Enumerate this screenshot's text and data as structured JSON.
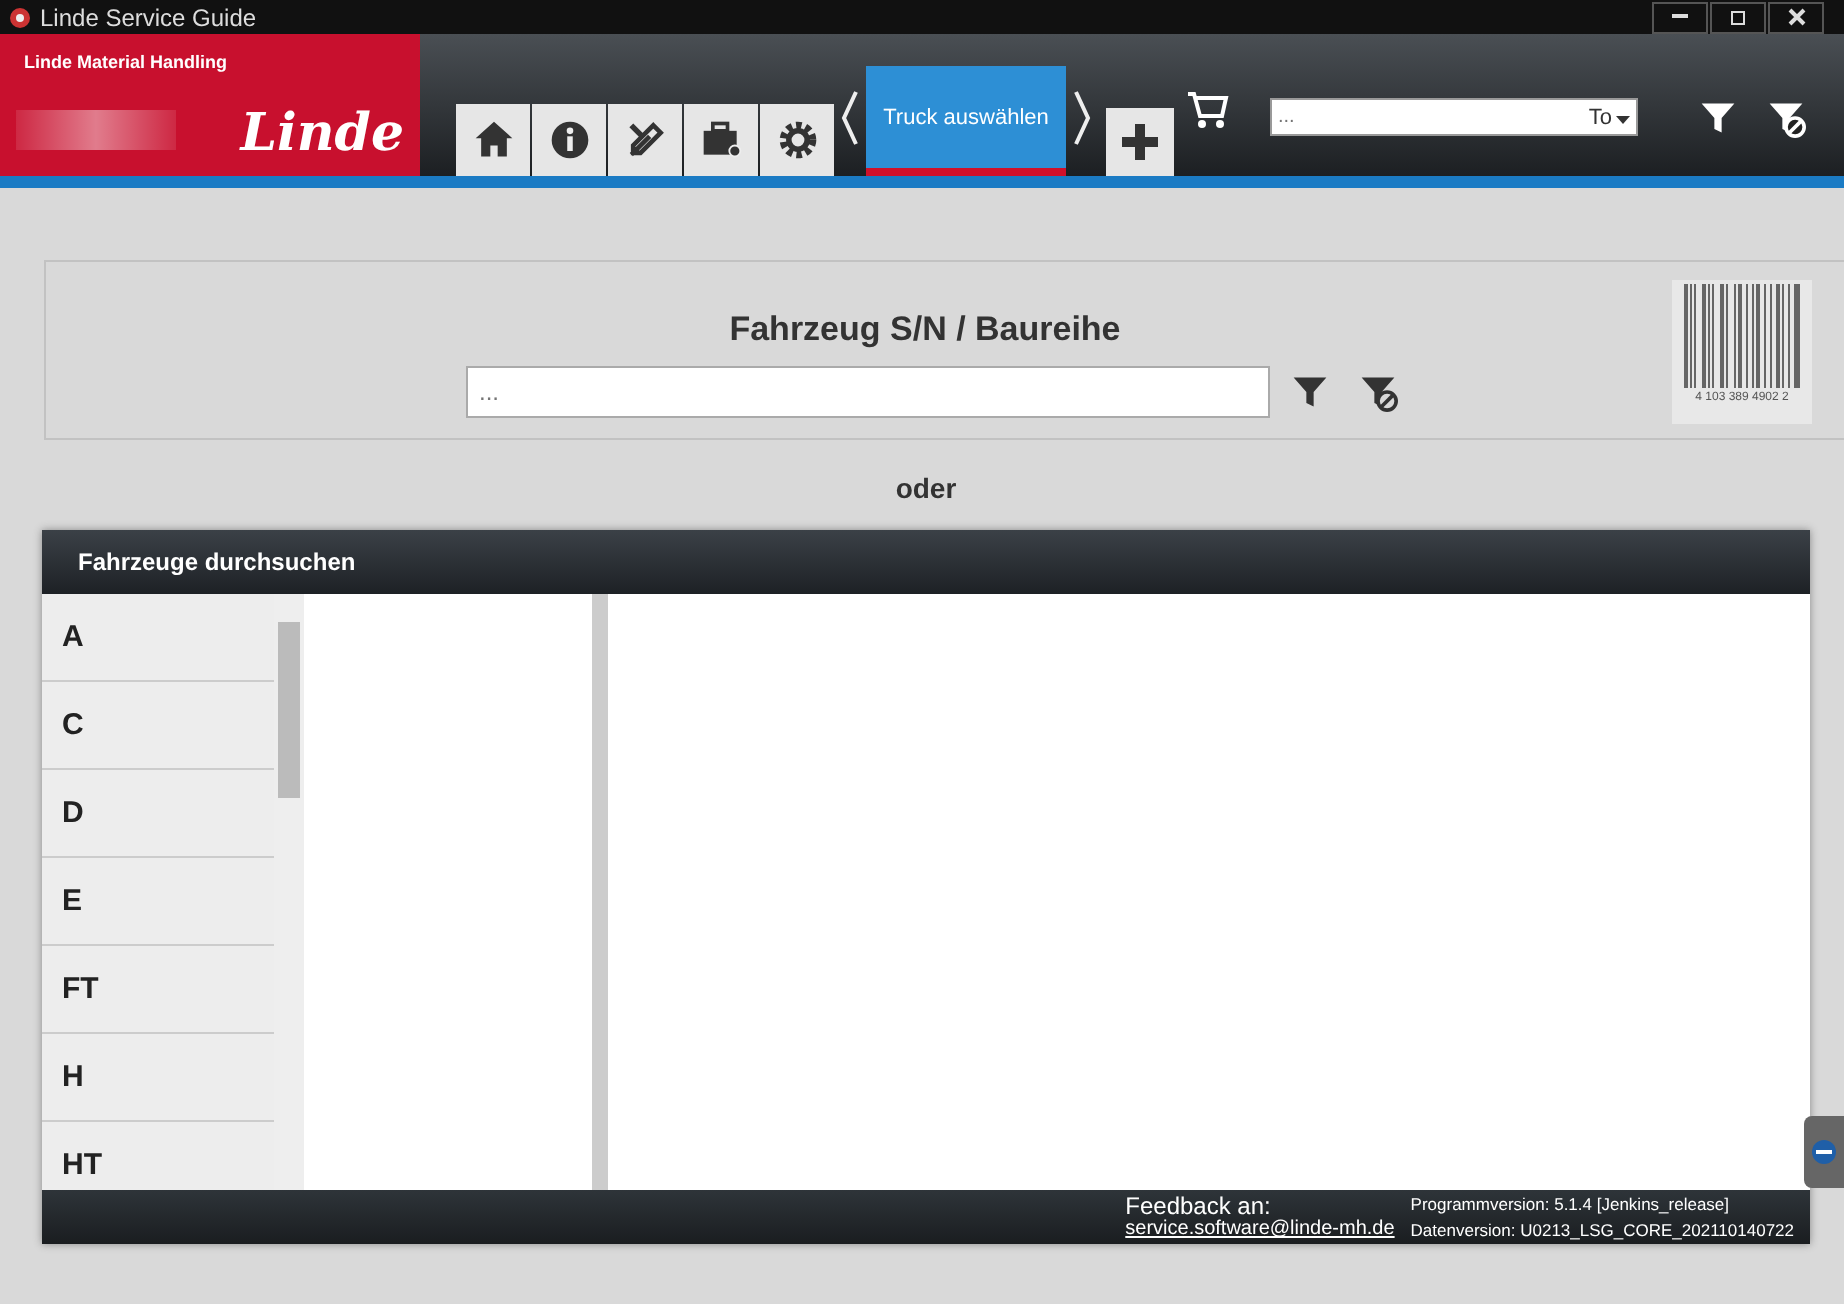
{
  "window": {
    "title": "Linde Service Guide"
  },
  "header": {
    "brand": "Linde Material Handling",
    "logo": "Linde",
    "tabs": [
      {
        "kind": "home",
        "selected": false
      },
      {
        "kind": "info",
        "selected": false
      },
      {
        "kind": "tools",
        "selected": false
      },
      {
        "kind": "toolbox",
        "selected": false
      },
      {
        "kind": "settings",
        "selected": false
      },
      {
        "kind": "text",
        "label": "Truck auswählen",
        "selected": true
      }
    ],
    "search": {
      "placeholder": "...",
      "option": "To"
    }
  },
  "search_panel": {
    "title": "Fahrzeug S/N / Baureihe",
    "placeholder": "...",
    "barcode": "4 103 389 4902 2"
  },
  "separator": "oder",
  "browser": {
    "title": "Fahrzeuge durchsuchen",
    "letters": [
      {
        "label": "A",
        "selected": false
      },
      {
        "label": "C",
        "selected": false
      },
      {
        "label": "D",
        "selected": false
      },
      {
        "label": "E",
        "selected": false
      },
      {
        "label": "FT",
        "selected": false
      },
      {
        "label": "H",
        "selected": false
      },
      {
        "label": "HT",
        "selected": false
      }
    ]
  },
  "footer": {
    "feedback_label": "Feedback an:",
    "email": "service.software@linde-mh.de",
    "program_version": "Programmversion: 5.1.4 [Jenkins_release]",
    "data_version": "Datenversion: U0213_LSG_CORE_202110140722"
  }
}
